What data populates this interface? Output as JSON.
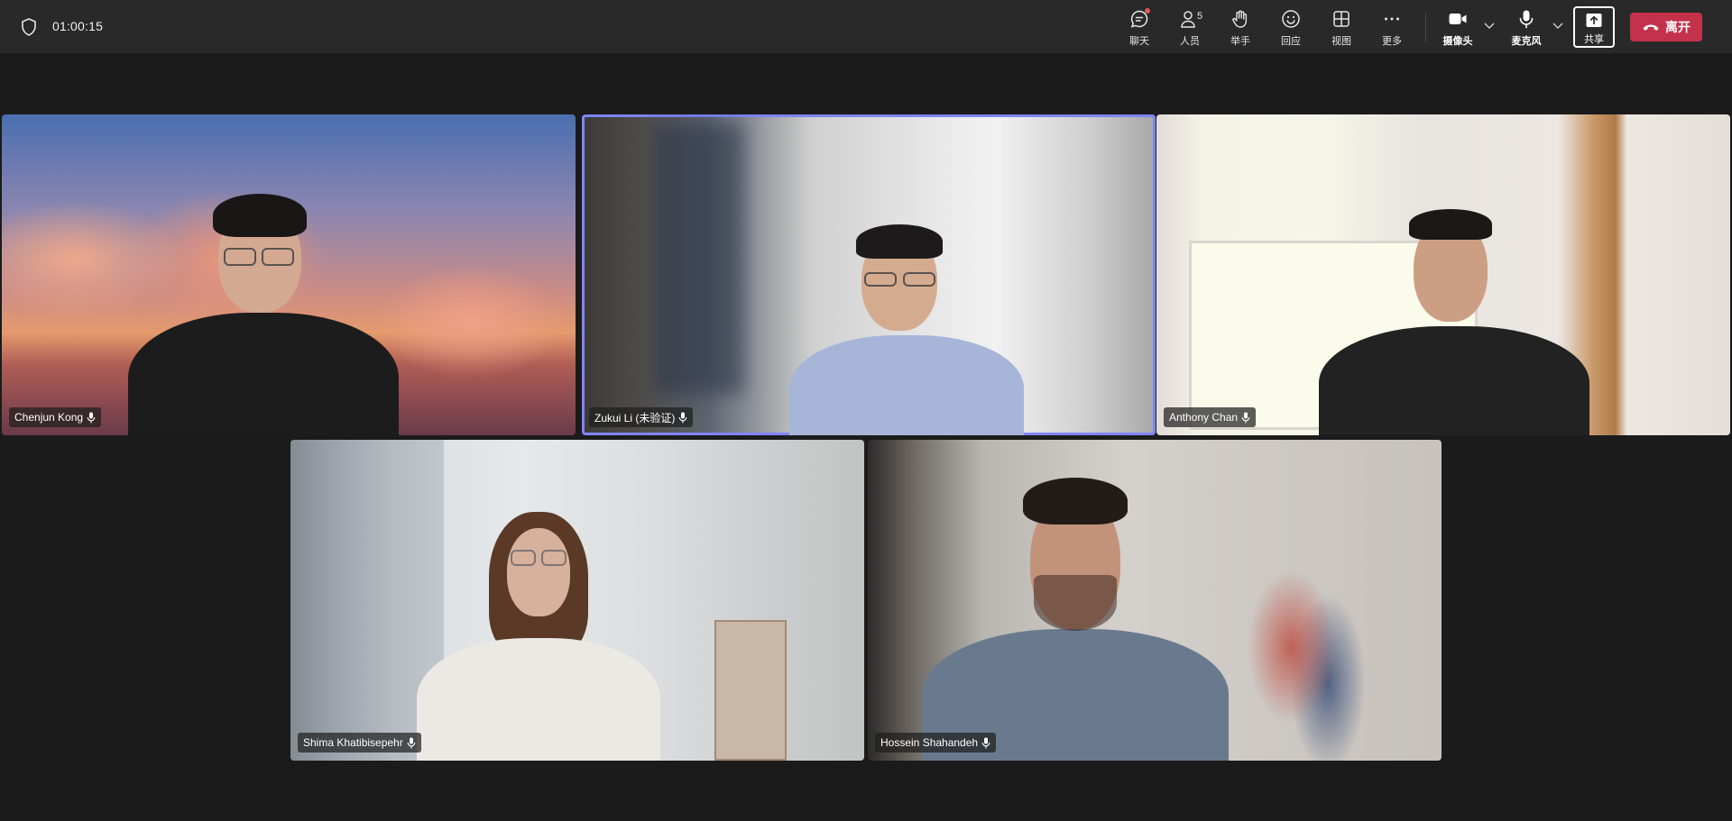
{
  "meeting": {
    "timer": "01:00:15"
  },
  "toolbar": {
    "chat_label": "聊天",
    "people_label": "人员",
    "people_count": "5",
    "raise_hand_label": "举手",
    "react_label": "回应",
    "view_label": "视图",
    "more_label": "更多",
    "camera_label": "摄像头",
    "mic_label": "麦克风",
    "share_label": "共享",
    "leave_label": "离开"
  },
  "colors": {
    "leave": "#c4314b",
    "active_speaker_border": "#7f85f5",
    "topbar": "#292929",
    "stage": "#1b1b1b"
  },
  "participants": [
    {
      "name": "Chenjun Kong"
    },
    {
      "name": "Zukui Li (未验证)"
    },
    {
      "name": "Anthony Chan"
    },
    {
      "name": "Shima Khatibisepehr"
    },
    {
      "name": "Hossein Shahandeh"
    }
  ]
}
